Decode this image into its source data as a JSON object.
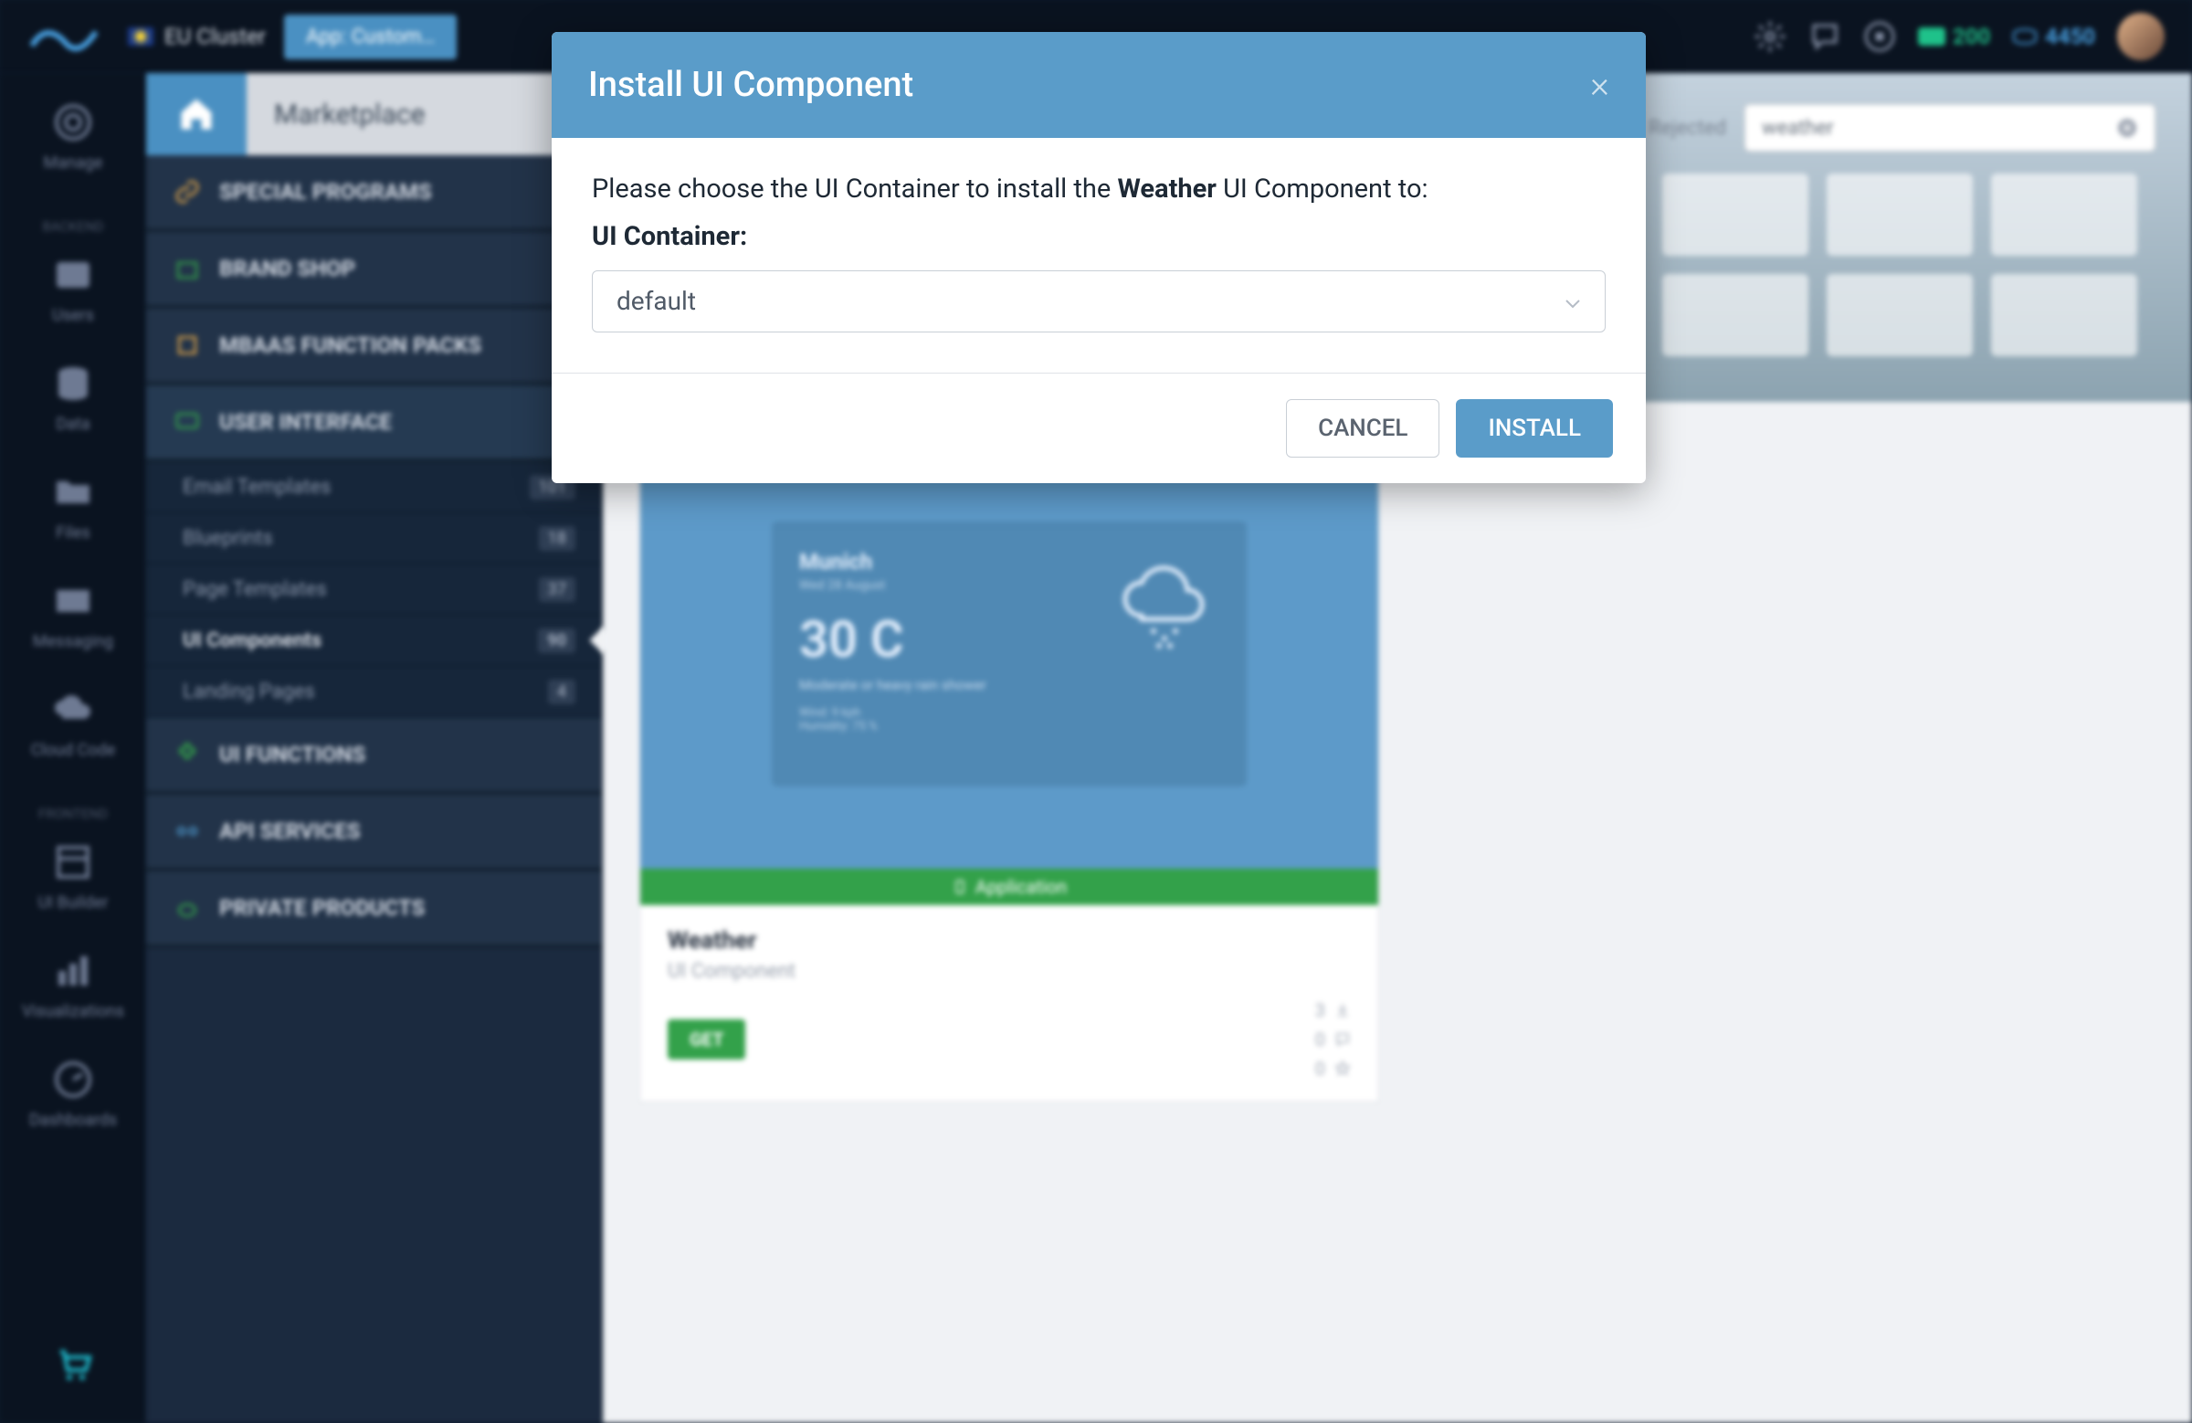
{
  "topbar": {
    "cluster": "EU Cluster",
    "app_pill": "App: Custom…",
    "stat_green": "200",
    "stat_blue": "4450"
  },
  "leftrail": {
    "items": {
      "manage": "Manage",
      "backend_header": "BACKEND",
      "users": "Users",
      "data": "Data",
      "files": "Files",
      "messaging": "Messaging",
      "cloud_code": "Cloud Code",
      "frontend_header": "FRONTEND",
      "ui_builder": "UI Builder",
      "visualizations": "Visualizations",
      "dashboards": "Dashboards"
    }
  },
  "sidebar": {
    "title": "Marketplace",
    "sections": [
      {
        "label": "SPECIAL PROGRAMS",
        "icon_color": "#e7a948"
      },
      {
        "label": "BRAND SHOP",
        "icon_color": "#33a14a"
      },
      {
        "label": "MBAAS FUNCTION PACKS",
        "icon_color": "#e7a948"
      },
      {
        "label": "USER INTERFACE",
        "icon_color": "#33a14a"
      },
      {
        "label": "UI FUNCTIONS",
        "icon_color": "#33a14a"
      },
      {
        "label": "API SERVICES",
        "icon_color": "#4a90c2"
      },
      {
        "label": "PRIVATE PRODUCTS",
        "icon_color": "#33a14a"
      }
    ],
    "subitems": [
      {
        "label": "Email Templates",
        "badge": "101"
      },
      {
        "label": "Blueprints",
        "badge": "18"
      },
      {
        "label": "Page Templates",
        "badge": "37"
      },
      {
        "label": "UI Components",
        "badge": "90",
        "active": true
      },
      {
        "label": "Landing Pages",
        "badge": "4"
      }
    ]
  },
  "main": {
    "search": {
      "status": "Rejected",
      "value": "weather"
    },
    "card": {
      "application_bar": "Application",
      "title": "Weather",
      "subtitle": "UI Component",
      "get": "GET",
      "stats": {
        "downloads": "3",
        "comments": "0",
        "stars": "0"
      },
      "preview": {
        "city": "Munich",
        "date": "Wed 28 August",
        "temp": "30 C",
        "desc": "Moderate or heavy rain shower",
        "wind": "Wind: 9 kph",
        "humidity": "Humidity: 75 %"
      }
    }
  },
  "modal": {
    "title": "Install UI Component",
    "text_prefix": "Please choose the UI Container to install the ",
    "text_bold": "Weather",
    "text_suffix": " UI Component to:",
    "label": "UI Container:",
    "select_value": "default",
    "cancel": "CANCEL",
    "install": "INSTALL"
  }
}
